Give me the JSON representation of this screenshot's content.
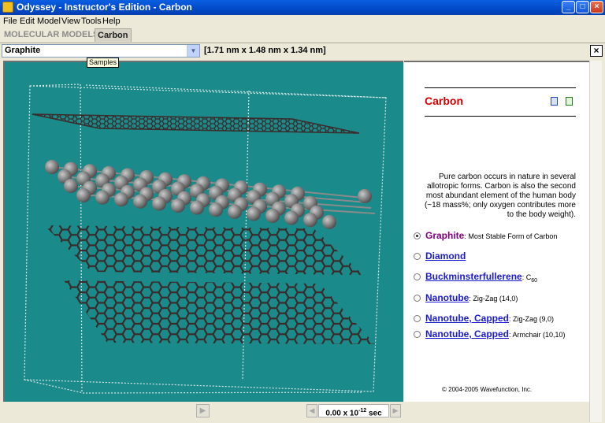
{
  "window": {
    "title": "Odyssey - Instructor's Edition - Carbon"
  },
  "menu": [
    "File",
    "Edit",
    "Model",
    "View",
    "Tools",
    "Help"
  ],
  "tabs": {
    "molecular_models": "MOLECULAR MODELS",
    "carbon": "Carbon"
  },
  "toolbar": {
    "sample_value": "Graphite",
    "dimensions": "[1.71 nm x 1.48 nm x 1.34 nm]",
    "tooltip": "Samples",
    "close_label": "×"
  },
  "info": {
    "title": "Carbon",
    "description": "Pure carbon occurs in nature in several allotropic forms. Carbon is also the second most abundant element of the human body (~18 mass%; only oxygen contributes more to the body weight).",
    "options": [
      {
        "label": "Graphite",
        "detail": ": Most Stable Form of Carbon",
        "selected": true
      },
      {
        "label": "Diamond",
        "detail": "",
        "selected": false
      },
      {
        "label": "Buckminsterfullerene",
        "detail": ": C",
        "sub": "60",
        "selected": false
      },
      {
        "label": "Nanotube",
        "detail": ": Zig-Zag (14,0)",
        "selected": false
      },
      {
        "label": "Nanotube, Capped",
        "detail": ": Zig-Zag (9,0)",
        "selected": false
      },
      {
        "label": "Nanotube, Capped",
        "detail": ": Armchair (10,10)",
        "selected": false
      }
    ],
    "copyright": "© 2004-2005 Wavefunction, Inc."
  },
  "playback": {
    "time_value": "0.00 x 10",
    "time_exp": "-12",
    "time_unit": " sec"
  },
  "colors": {
    "viewer_bg": "#1b8a8a",
    "title_red": "#d40000",
    "link_blue": "#1a1ad0",
    "selected_purple": "#800080"
  }
}
